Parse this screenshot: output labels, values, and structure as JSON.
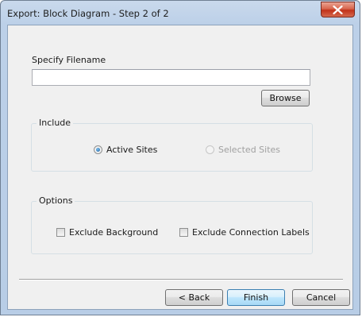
{
  "window": {
    "title": "Export: Block Diagram - Step 2 of 2"
  },
  "filename": {
    "label": "Specify Filename",
    "value": "",
    "placeholder": "",
    "browse_label": "Browse"
  },
  "include": {
    "title": "Include",
    "options": [
      {
        "label": "Active Sites",
        "checked": true,
        "enabled": true
      },
      {
        "label": "Selected Sites",
        "checked": false,
        "enabled": false
      }
    ]
  },
  "options": {
    "title": "Options",
    "checkboxes": [
      {
        "label": "Exclude Background",
        "checked": false
      },
      {
        "label": "Exclude Connection Labels",
        "checked": false
      }
    ]
  },
  "buttons": {
    "back": "< Back",
    "finish": "Finish",
    "cancel": "Cancel"
  },
  "icons": {
    "close": "close-x-icon"
  }
}
